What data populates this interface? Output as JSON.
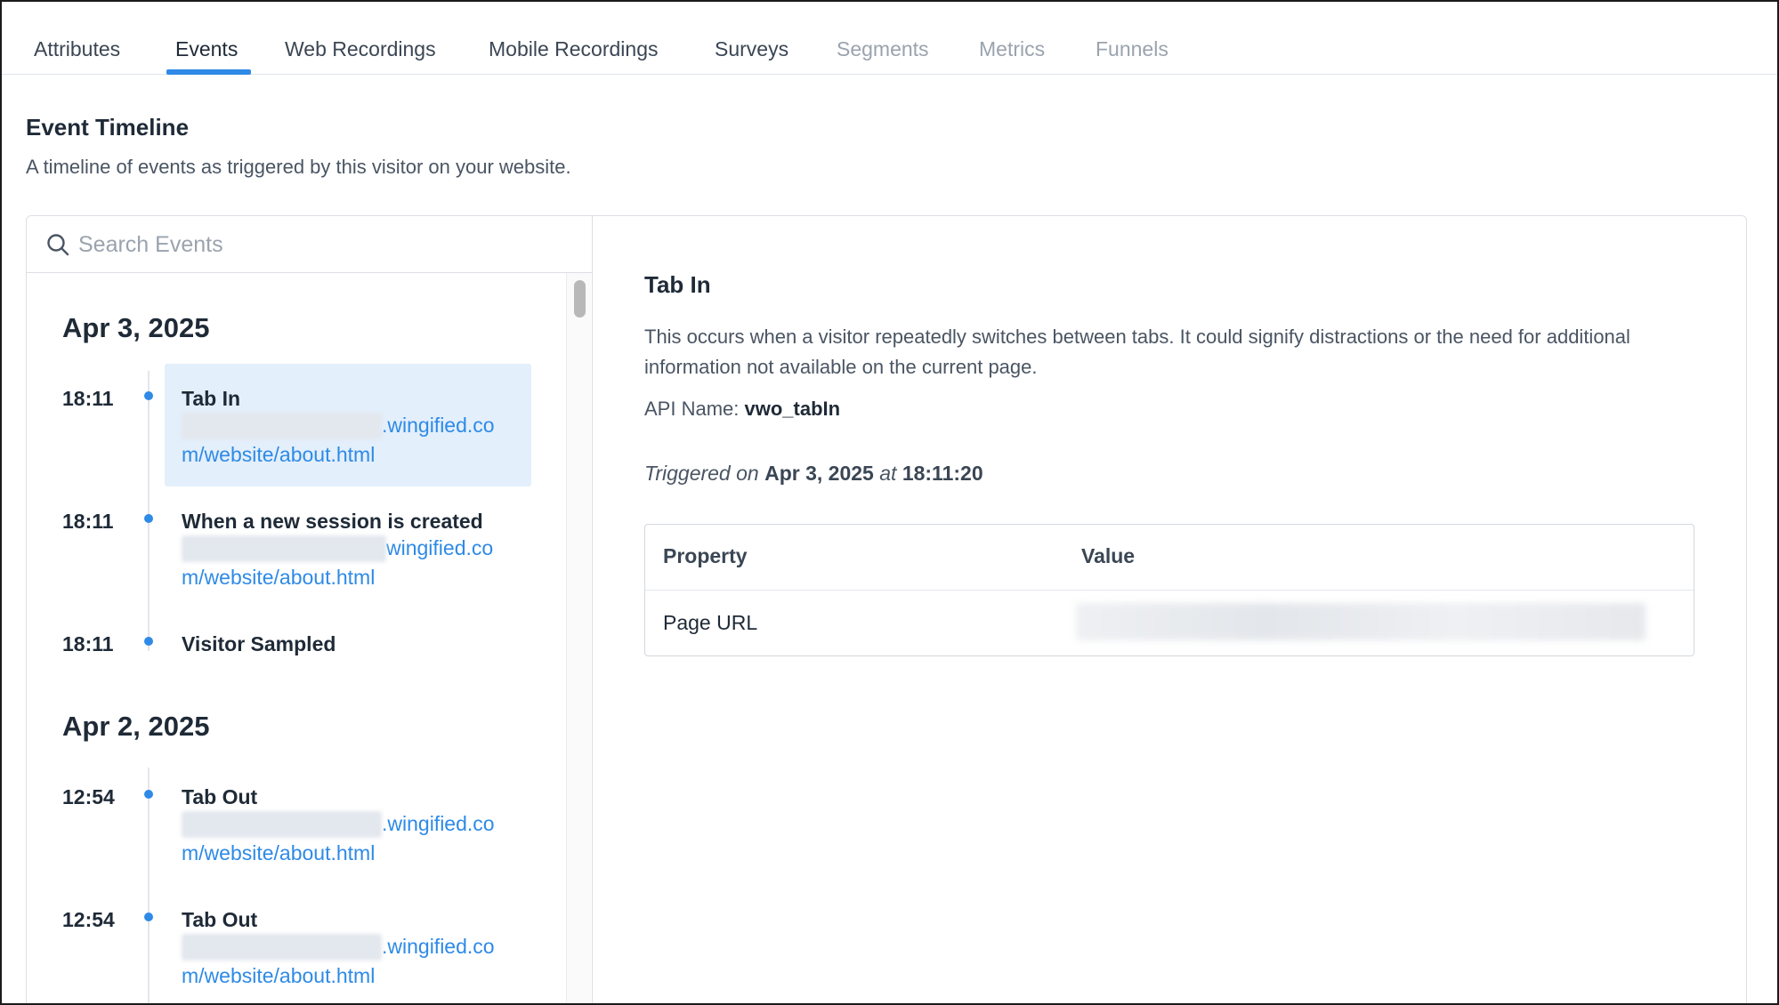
{
  "tabs": [
    {
      "label": "Attributes",
      "state": "normal"
    },
    {
      "label": "Events",
      "state": "active"
    },
    {
      "label": "Web Recordings",
      "state": "normal"
    },
    {
      "label": "Mobile Recordings",
      "state": "normal"
    },
    {
      "label": "Surveys",
      "state": "normal"
    },
    {
      "label": "Segments",
      "state": "disabled"
    },
    {
      "label": "Metrics",
      "state": "disabled"
    },
    {
      "label": "Funnels",
      "state": "disabled"
    }
  ],
  "header": {
    "title": "Event Timeline",
    "description": "A timeline of events as triggered by this visitor on your website."
  },
  "search": {
    "placeholder": "Search Events",
    "value": "",
    "icon": "search-icon"
  },
  "timeline": {
    "groups": [
      {
        "date": "Apr 3, 2025",
        "events": [
          {
            "time": "18:11",
            "name": "Tab In",
            "url_domain": ".wingified.co",
            "url_path": "m/website/about.html",
            "selected": true
          },
          {
            "time": "18:11",
            "name": "When a new session is created",
            "url_domain": "wingified.co",
            "url_path": "m/website/about.html",
            "selected": false
          },
          {
            "time": "18:11",
            "name": "Visitor Sampled",
            "selected": false
          }
        ]
      },
      {
        "date": "Apr 2, 2025",
        "events": [
          {
            "time": "12:54",
            "name": "Tab Out",
            "url_domain": ".wingified.co",
            "url_path": "m/website/about.html",
            "selected": false
          },
          {
            "time": "12:54",
            "name": "Tab Out",
            "url_domain": ".wingified.co",
            "url_path": "m/website/about.html",
            "selected": false
          }
        ]
      }
    ]
  },
  "detail": {
    "title": "Tab In",
    "description": "This occurs when a visitor repeatedly switches between tabs. It could signify distractions or the need for additional information not available on the current page.",
    "api_label": "API Name:",
    "api_value": "vwo_tabIn",
    "triggered_prefix": "Triggered on",
    "triggered_date": "Apr 3, 2025",
    "triggered_at": "at",
    "triggered_time": "18:11:20",
    "table": {
      "headers": [
        "Property",
        "Value"
      ],
      "rows": [
        {
          "property": "Page URL",
          "value": ""
        }
      ]
    }
  },
  "colors": {
    "accent": "#2e8ae6",
    "selected_bg": "#e3effb",
    "disabled_text": "#9aa3ae"
  }
}
